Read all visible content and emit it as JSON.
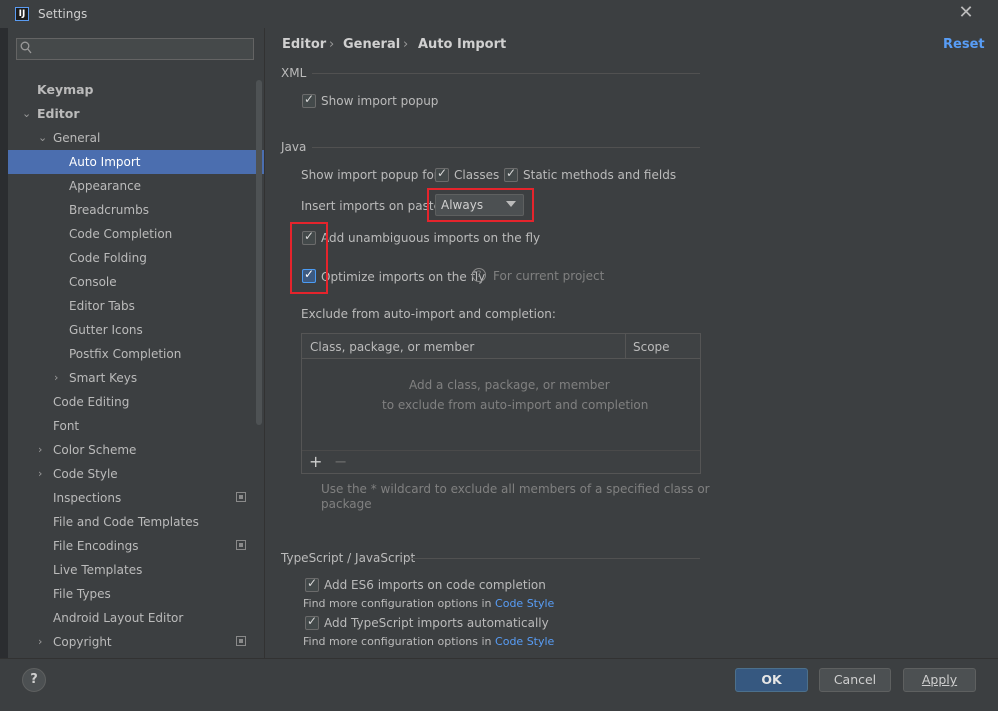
{
  "window": {
    "title": "Settings",
    "app_icon": "IJ",
    "close_icon": "close-icon"
  },
  "search": {
    "placeholder": ""
  },
  "sidebar": {
    "items": [
      {
        "label": "Keymap"
      },
      {
        "label": "Editor"
      },
      {
        "label": "General"
      },
      {
        "label": "Auto Import"
      },
      {
        "label": "Appearance"
      },
      {
        "label": "Breadcrumbs"
      },
      {
        "label": "Code Completion"
      },
      {
        "label": "Code Folding"
      },
      {
        "label": "Console"
      },
      {
        "label": "Editor Tabs"
      },
      {
        "label": "Gutter Icons"
      },
      {
        "label": "Postfix Completion"
      },
      {
        "label": "Smart Keys"
      },
      {
        "label": "Code Editing"
      },
      {
        "label": "Font"
      },
      {
        "label": "Color Scheme"
      },
      {
        "label": "Code Style"
      },
      {
        "label": "Inspections"
      },
      {
        "label": "File and Code Templates"
      },
      {
        "label": "File Encodings"
      },
      {
        "label": "Live Templates"
      },
      {
        "label": "File Types"
      },
      {
        "label": "Android Layout Editor"
      },
      {
        "label": "Copyright"
      }
    ]
  },
  "breadcrumb": {
    "items": [
      "Editor",
      "General",
      "Auto Import"
    ],
    "separator": "›"
  },
  "reset_label": "Reset",
  "xml": {
    "title": "XML",
    "show_import_popup": "Show import popup"
  },
  "java": {
    "title": "Java",
    "show_popup_for": "Show import popup for:",
    "classes": "Classes",
    "static_methods": "Static methods and fields",
    "insert_on_paste": "Insert imports on paste:",
    "insert_on_paste_value": "Always",
    "add_unambiguous": "Add unambiguous imports on the fly",
    "optimize_imports": "Optimize imports on the fly",
    "for_current_project": "For current project",
    "exclude_title": "Exclude from auto-import and completion:",
    "table": {
      "col_member": "Class, package, or member",
      "col_scope": "Scope",
      "empty_line1": "Add a class, package, or member",
      "empty_line2": "to exclude from auto-import and completion",
      "add": "+",
      "remove": "−"
    },
    "wildcard_hint_1": "Use the * wildcard to exclude all members of a specified class or",
    "wildcard_hint_2": "package"
  },
  "ts": {
    "title": "TypeScript / JavaScript",
    "add_es6": "Add ES6 imports on code completion",
    "find_more_1": "Find more configuration options in",
    "code_style_link_1": "Code Style",
    "add_ts_auto": "Add TypeScript imports automatically",
    "find_more_2": "Find more configuration options in",
    "code_style_link_2": "Code Style"
  },
  "footer": {
    "help": "?",
    "ok": "OK",
    "cancel": "Cancel",
    "apply": "Apply"
  },
  "colors": {
    "accent": "#4b6eaf",
    "link": "#589df6",
    "highlight": "#e5242c"
  }
}
